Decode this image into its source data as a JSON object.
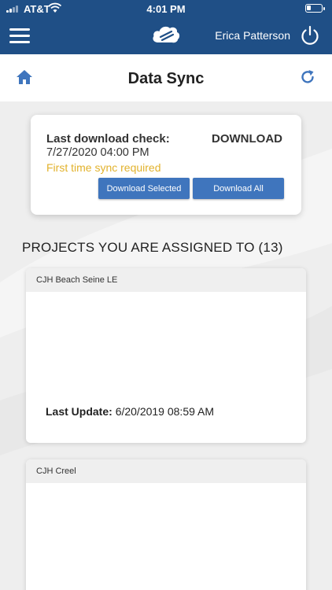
{
  "status_bar": {
    "carrier": "AT&T",
    "time": "4:01 PM"
  },
  "header": {
    "user_name": "Erica Patterson",
    "icons": {
      "menu": "hamburger-menu-icon",
      "logo": "cloud-logo",
      "power": "power-icon"
    },
    "colors": {
      "bar": "#1f4f86"
    }
  },
  "page": {
    "title": "Data Sync",
    "icons": {
      "home": "home-icon",
      "refresh": "refresh-icon"
    },
    "accent": "#3f75bd"
  },
  "download": {
    "label": "Last download check:",
    "date": "7/27/2020 04:00 PM",
    "warning": "First time sync required",
    "warning_color": "#e2b22c",
    "heading": "DOWNLOAD",
    "btn_selected": "Download Selected",
    "btn_all": "Download All"
  },
  "projects": {
    "heading": "PROJECTS YOU ARE ASSIGNED TO (13)",
    "items": [
      {
        "name": "CJH Beach Seine LE",
        "last_update_label": "Last Update:",
        "last_update_value": "6/20/2019 08:59 AM"
      },
      {
        "name": "CJH Creel"
      }
    ]
  }
}
